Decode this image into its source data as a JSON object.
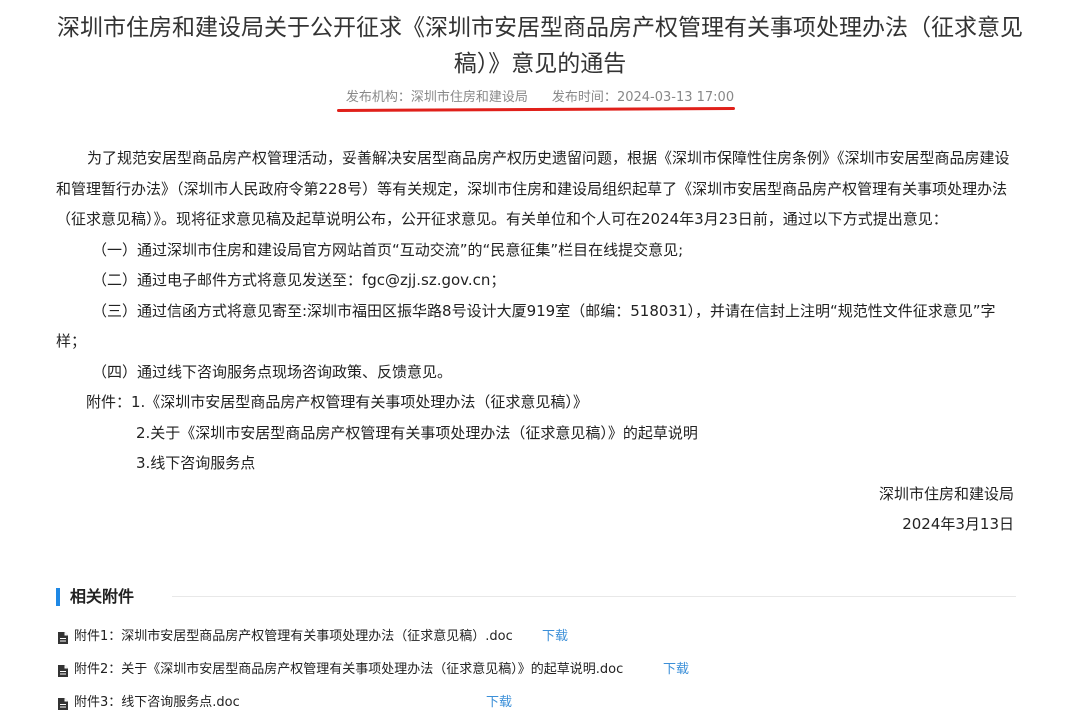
{
  "article": {
    "title": "深圳市住房和建设局关于公开征求《深圳市安居型商品房产权管理有关事项处理办法（征求意见稿）》意见的通告",
    "publisher_label": "发布机构：",
    "publisher": "深圳市住房和建设局",
    "time_label": "发布时间：",
    "time": "2024-03-13 17:00",
    "intro": "为了规范安居型商品房产权管理活动，妥善解决安居型商品房产权历史遗留问题，根据《深圳市保障性住房条例》《深圳市安居型商品房建设和管理暂行办法》（深圳市人民政府令第228号）等有关规定，深圳市住房和建设局组织起草了《深圳市安居型商品房产权管理有关事项处理办法（征求意见稿）》。现将征求意见稿及起草说明公布，公开征求意见。有关单位和个人可在2024年3月23日前，通过以下方式提出意见：",
    "items": [
      "（一）通过深圳市住房和建设局官方网站首页“互动交流”的“民意征集”栏目在线提交意见;",
      "（二）通过电子邮件方式将意见发送至：fgc@zjj.sz.gov.cn；",
      "（三）通过信函方式将意见寄至:深圳市福田区振华路8号设计大厦919室（邮编：518031），并请在信封上注明“规范性文件征求意见”字样；",
      "（四）通过线下咨询服务点现场咨询政策、反馈意见。"
    ],
    "attachments_intro": "附件：1.《深圳市安居型商品房产权管理有关事项处理办法（征求意见稿）》",
    "attachments_more": [
      "2.关于《深圳市安居型商品房产权管理有关事项处理办法（征求意见稿）》的起草说明",
      "3.线下咨询服务点"
    ],
    "signature": "深圳市住房和建设局",
    "date": "2024年3月13日"
  },
  "related": {
    "heading": "相关附件",
    "download_label": "下载",
    "files": [
      "附件1：深圳市安居型商品房产权管理有关事项处理办法（征求意见稿）.doc",
      "附件2：关于《深圳市安居型商品房产权管理有关事项处理办法（征求意见稿）》的起草说明.doc",
      "附件3：线下咨询服务点.doc"
    ]
  },
  "colors": {
    "accent_blue": "#1e88e5",
    "link_blue": "#3b8fd8",
    "underline_red": "#e0201a",
    "meta_gray": "#888888"
  },
  "icons": {
    "file": "file-icon"
  }
}
